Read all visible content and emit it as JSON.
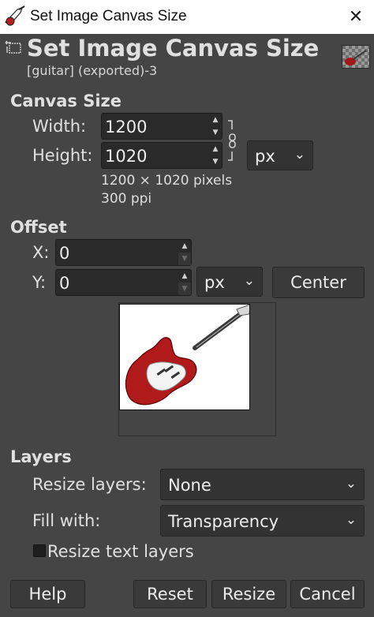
{
  "window": {
    "title": "Set Image Canvas Size",
    "close_glyph": "✕"
  },
  "header": {
    "title": "Set Image Canvas Size",
    "subtitle": "[guitar] (exported)-3"
  },
  "canvas_size": {
    "section_label": "Canvas Size",
    "width_label": "Width:",
    "width_value": "1200",
    "height_label": "Height:",
    "height_value": "1020",
    "unit": "px",
    "info_pixels": "1200 × 1020 pixels",
    "info_ppi": "300 ppi"
  },
  "offset": {
    "section_label": "Offset",
    "x_label": "X:",
    "x_value": "0",
    "y_label": "Y:",
    "y_value": "0",
    "unit": "px",
    "center_button": "Center"
  },
  "layers": {
    "section_label": "Layers",
    "resize_layers_label": "Resize layers:",
    "resize_layers_value": "None",
    "fill_with_label": "Fill with:",
    "fill_with_value": "Transparency",
    "resize_text_layers_label": "Resize text layers",
    "resize_text_layers_checked": false
  },
  "buttons": {
    "help": "Help",
    "reset": "Reset",
    "resize": "Resize",
    "cancel": "Cancel"
  },
  "icons": {
    "spin_up": "▲",
    "spin_down": "▼",
    "dropdown": "⌄"
  },
  "colors": {
    "background": "#454545",
    "field": "#2a2a2a",
    "titlebar": "#ffffff"
  }
}
